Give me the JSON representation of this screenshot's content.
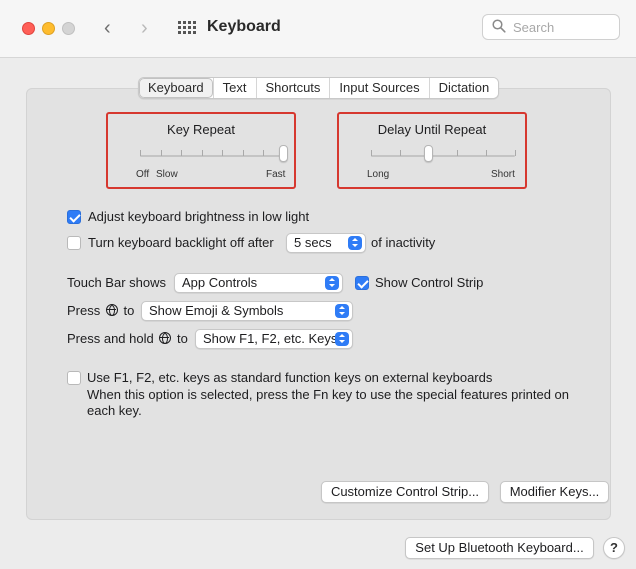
{
  "window": {
    "title": "Keyboard"
  },
  "toolbar": {
    "back_icon": "chevron-left-icon",
    "forward_icon": "chevron-right-icon",
    "grid_icon": "show-all-grid-icon"
  },
  "search": {
    "placeholder": "Search",
    "value": ""
  },
  "tabs": [
    {
      "label": "Keyboard",
      "selected": true
    },
    {
      "label": "Text",
      "selected": false
    },
    {
      "label": "Shortcuts",
      "selected": false
    },
    {
      "label": "Input Sources",
      "selected": false
    },
    {
      "label": "Dictation",
      "selected": false
    }
  ],
  "key_repeat": {
    "title": "Key Repeat",
    "min_label": "Off",
    "slow_label": "Slow",
    "max_label": "Fast",
    "steps": 8,
    "value_step": 7
  },
  "delay_until_repeat": {
    "title": "Delay Until Repeat",
    "min_label": "Long",
    "max_label": "Short",
    "steps": 6,
    "value_step": 2
  },
  "brightness": {
    "label": "Adjust keyboard brightness in low light",
    "checked": true
  },
  "backlight_off": {
    "label_before": "Turn keyboard backlight off after",
    "value": "5 secs",
    "label_after": "of inactivity",
    "checked": false
  },
  "touch_bar": {
    "label": "Touch Bar shows",
    "value": "App Controls",
    "control_strip_label": "Show Control Strip",
    "control_strip_checked": true
  },
  "press_globe": {
    "label_before": "Press",
    "label_after": "to",
    "value": "Show Emoji & Symbols"
  },
  "press_hold_globe": {
    "label_before": "Press and hold",
    "label_after": "to",
    "value": "Show F1, F2, etc. Keys"
  },
  "function_keys": {
    "label": "Use F1, F2, etc. keys as standard function keys on external keyboards",
    "description": "When this option is selected, press the Fn key to use the special features printed on each key.",
    "checked": false
  },
  "buttons": {
    "customize": "Customize Control Strip...",
    "modifier": "Modifier Keys...",
    "bluetooth": "Set Up Bluetooth Keyboard...",
    "help": "?"
  },
  "colors": {
    "accent": "#2f7cf6",
    "highlight_box": "#d6382f"
  }
}
